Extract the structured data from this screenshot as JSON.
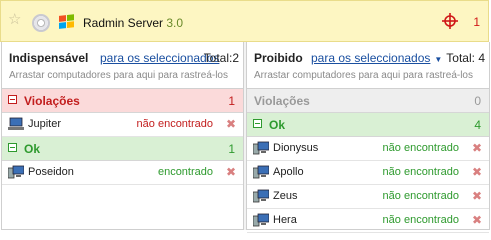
{
  "header": {
    "app_name": "Radmin Server",
    "version": "3.0",
    "alert_count": "1",
    "icons": [
      "star-icon",
      "cd-icon",
      "windows-icon",
      "target-icon"
    ]
  },
  "panels": {
    "left": {
      "title": "Indispensável",
      "link": "para os seleccionados",
      "total": "Total:2",
      "hint": "Arrastar computadores para aqui para rastreá-los",
      "groups": [
        {
          "label": "Violações",
          "count": "1",
          "items": [
            {
              "name": "Jupiter",
              "status": "não encontrado"
            }
          ]
        },
        {
          "label": "Ok",
          "count": "1",
          "items": [
            {
              "name": "Poseidon",
              "status": "encontrado"
            }
          ]
        }
      ]
    },
    "right": {
      "title": "Proibido",
      "link": "para os seleccionados",
      "total": "Total: 4",
      "hint": "Arrastar computadores para aqui para rastreá-los",
      "groups": [
        {
          "label": "Violações",
          "count": "0",
          "items": []
        },
        {
          "label": "Ok",
          "count": "4",
          "items": [
            {
              "name": "Dionysus",
              "status": "não encontrado"
            },
            {
              "name": "Apollo",
              "status": "não encontrado"
            },
            {
              "name": "Zeus",
              "status": "não encontrado"
            },
            {
              "name": "Hera",
              "status": "não encontrado"
            }
          ]
        }
      ]
    }
  },
  "remove_glyph": "✖",
  "colors": {
    "violation": "#c21d1d",
    "ok": "#2e9a2e",
    "link": "#1a4fa0",
    "header_bg": "#fdf6c2"
  }
}
